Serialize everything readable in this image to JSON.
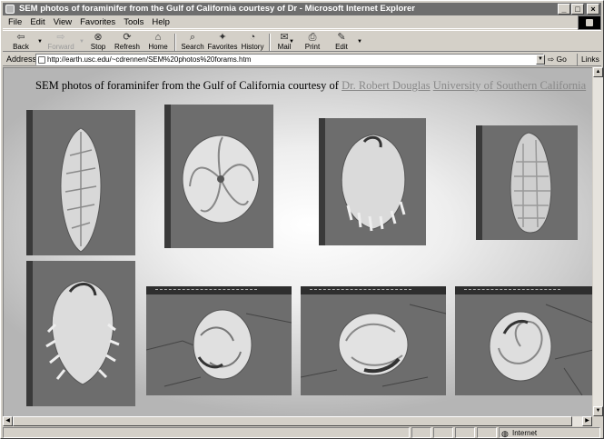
{
  "window": {
    "title": "SEM photos of foraminifer from the Gulf of California courtesy of Dr - Microsoft Internet Explorer",
    "controls": [
      "_",
      "□",
      "×"
    ]
  },
  "menu": [
    "File",
    "Edit",
    "View",
    "Favorites",
    "Tools",
    "Help"
  ],
  "toolbar": {
    "back": "Back",
    "forward": "Forward",
    "stop": "Stop",
    "refresh": "Refresh",
    "home": "Home",
    "search": "Search",
    "favorites": "Favorites",
    "history": "History",
    "mail": "Mail",
    "print": "Print",
    "edit": "Edit"
  },
  "address": {
    "label": "Address",
    "url": "http://earth.usc.edu/~cdrennen/SEM%20photos%20forams.htm",
    "go": "Go",
    "links": "Links"
  },
  "page": {
    "heading_text": "SEM photos of foraminifer from the Gulf of California courtesy of",
    "link_author": "Dr. Robert Douglas",
    "link_university": "University of Southern California"
  },
  "status": {
    "zone": "Internet"
  }
}
